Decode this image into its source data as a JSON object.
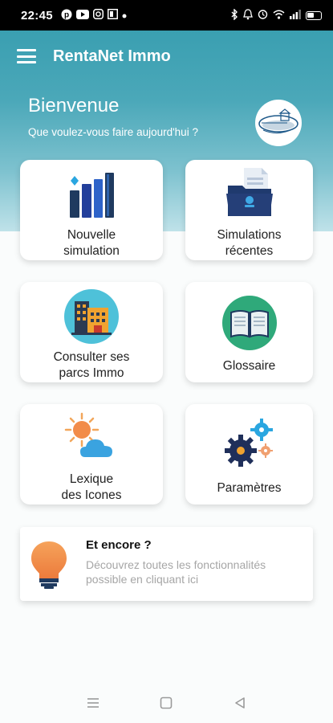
{
  "status_bar": {
    "time": "22:45",
    "left_icons": [
      "pinterest-icon",
      "youtube-icon",
      "instagram-icon",
      "app-icon",
      "dot-icon"
    ],
    "right_icons": [
      "bluetooth-icon",
      "vibrate-icon",
      "alarm-icon",
      "wifi-icon",
      "signal-icon",
      "battery-icon"
    ]
  },
  "app_bar": {
    "menu_icon": "hamburger-menu-icon",
    "title": "RentaNet Immo"
  },
  "header": {
    "greeting": "Bienvenue",
    "subtitle": "Que voulez-vous faire aujourd'hui ?"
  },
  "cards": [
    {
      "label_line1": "Nouvelle",
      "label_line2": "simulation",
      "icon": "bar-chart-icon"
    },
    {
      "label_line1": "Simulations",
      "label_line2": "récentes",
      "icon": "folder-document-icon"
    },
    {
      "label_line1": "Consulter ses",
      "label_line2": "parcs Immo",
      "icon": "buildings-icon"
    },
    {
      "label_line1": "Glossaire",
      "label_line2": "",
      "icon": "open-book-icon"
    },
    {
      "label_line1": "Lexique",
      "label_line2": "des Icones",
      "icon": "sun-cloud-icon"
    },
    {
      "label_line1": "Paramètres",
      "label_line2": "",
      "icon": "gears-icon"
    }
  ],
  "more": {
    "title": "Et encore ?",
    "description": "Découvrez toutes les fonctionnalités possible en cliquant ici",
    "icon": "lightbulb-icon"
  },
  "nav_bar": {
    "items": [
      "recents-icon",
      "home-icon",
      "back-icon"
    ]
  },
  "colors": {
    "hero_top": "#3a9fb1",
    "hero_bottom": "#bfe2e9",
    "accent_dark": "#1f3a5f",
    "muted_text": "#a6a6a6"
  }
}
